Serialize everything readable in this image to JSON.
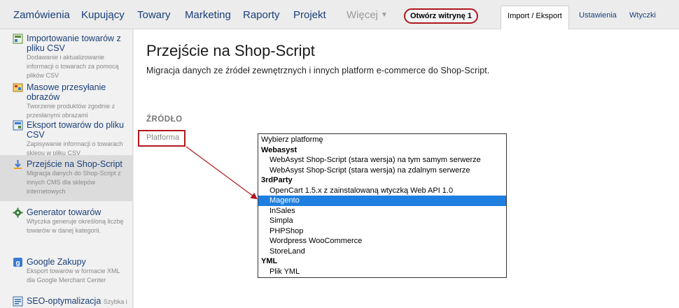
{
  "nav": {
    "items": [
      "Zamówienia",
      "Kupujący",
      "Towary",
      "Marketing",
      "Raporty",
      "Projekt"
    ],
    "more_label": "Więcej",
    "store_button": "Otwórz witrynę 1",
    "right_tabs": [
      "Import / Eksport",
      "Ustawienia",
      "Wtyczki"
    ],
    "active_tab": "Import / Eksport"
  },
  "sidebar": {
    "items": [
      {
        "title": "Importowanie towarów z pliku CSV",
        "desc": "Dodawanie i aktualizowanie informacji o towarach za pomocą plików CSV",
        "icon": "csv-import-icon"
      },
      {
        "title": "Masowe przesyłanie obrazów",
        "desc": "Tworzenie produktów zgodnie z przesłanymi obrazami",
        "icon": "images-icon"
      },
      {
        "title": "Eksport towarów do pliku CSV",
        "desc": "Zapisywanie informacji o towarach sklepu w pliku CSV",
        "icon": "csv-export-icon"
      },
      {
        "title": "Przejście na Shop-Script",
        "desc": "Migracja danych do Shop-Script z innych CMS dla sklepów internetowych",
        "icon": "migrate-icon"
      },
      {
        "title": "Generator towarów",
        "desc": "Wtyczka generuje określoną liczbę towarów w danej kategorii.",
        "icon": "gear-icon"
      },
      {
        "title": "Google Zakupy",
        "desc": "Eksport towarów w formacie XML dla Google Merchant Center",
        "icon": "google-icon"
      },
      {
        "title": "SEO-optymalizacja",
        "desc": "Szybka i",
        "icon": "seo-icon"
      }
    ],
    "active_index": 3
  },
  "main": {
    "title": "Przejście na Shop-Script",
    "subtitle": "Migracja danych ze źródeł zewnętrznych i innych platform e-commerce do Shop-Script.",
    "section": "ŹRÓDŁO",
    "field_label": "Platforma"
  },
  "platform_list": {
    "options": [
      {
        "label": "Wybierz platformę",
        "kind": "plain"
      },
      {
        "label": "Webasyst",
        "kind": "group"
      },
      {
        "label": "WebAsyst Shop-Script (stara wersja) na tym samym serwerze",
        "kind": "child"
      },
      {
        "label": "WebAsyst Shop-Script (stara wersja) na zdalnym serwerze",
        "kind": "child"
      },
      {
        "label": "3rdParty",
        "kind": "group"
      },
      {
        "label": "OpenCart 1.5.x z zainstalowaną wtyczką Web API 1.0",
        "kind": "child"
      },
      {
        "label": "Magento",
        "kind": "child"
      },
      {
        "label": "InSales",
        "kind": "child"
      },
      {
        "label": "Simpla",
        "kind": "child"
      },
      {
        "label": "PHPShop",
        "kind": "child"
      },
      {
        "label": "Wordpress WooCommerce",
        "kind": "child"
      },
      {
        "label": "StoreLand",
        "kind": "child"
      },
      {
        "label": "YML",
        "kind": "group"
      },
      {
        "label": "Plik YML",
        "kind": "child"
      }
    ],
    "selected": "Magento"
  },
  "colors": {
    "link": "#1a3f7a",
    "highlight": "#b0181c",
    "selection": "#1f7fe0"
  }
}
